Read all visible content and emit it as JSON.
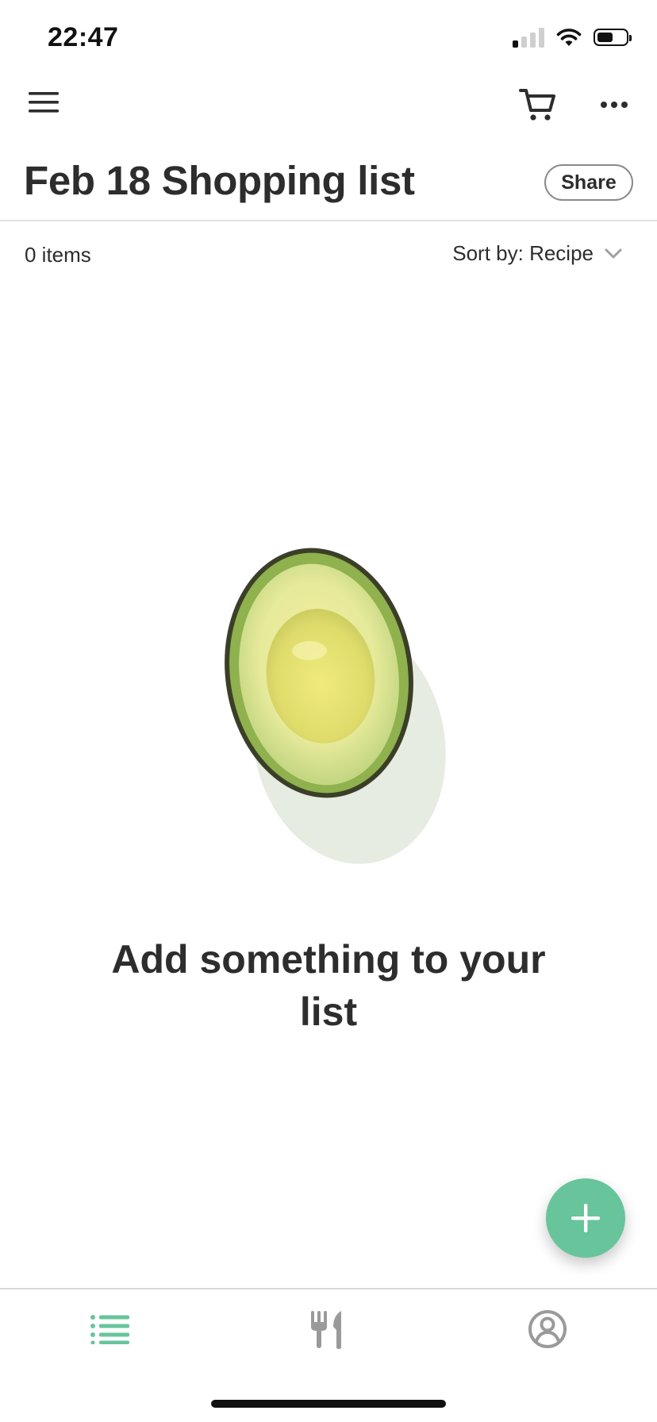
{
  "status_bar": {
    "time": "22:47",
    "signal_bars_active": 1,
    "signal_bars_total": 4,
    "battery_level": 0.55
  },
  "top_bar": {
    "icons": [
      "hamburger-menu-icon",
      "shopping-cart-icon",
      "more-horizontal-icon"
    ]
  },
  "header": {
    "title": "Feb 18 Shopping list",
    "share_label": "Share"
  },
  "list": {
    "count_label": "0 items",
    "sort_label": "Sort by: Recipe"
  },
  "empty_state": {
    "message": "Add something to your list"
  },
  "tabs": [
    {
      "name": "shopping-list",
      "icon": "list-icon",
      "active": true
    },
    {
      "name": "recipes",
      "icon": "fork-knife-icon",
      "active": false
    },
    {
      "name": "profile",
      "icon": "user-circle-icon",
      "active": false
    }
  ],
  "colors": {
    "accent": "#67c49b",
    "text": "#2d2d2d",
    "inactive_icon": "#9a9a9a",
    "divider": "#e2e2e2"
  }
}
